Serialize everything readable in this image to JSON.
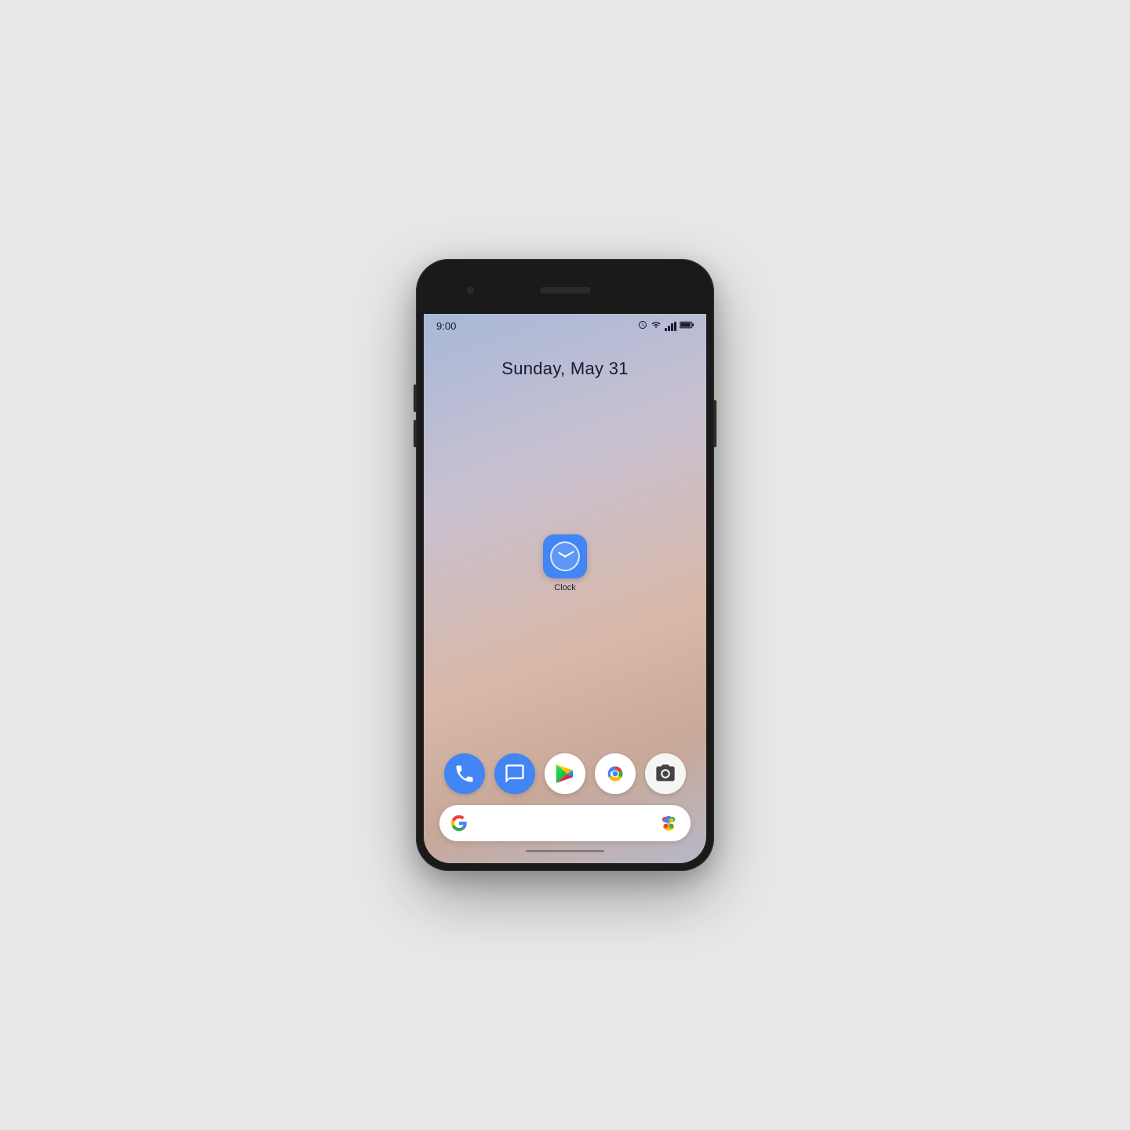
{
  "phone": {
    "status_bar": {
      "time": "9:00",
      "icons": [
        "alarm",
        "wifi",
        "signal",
        "battery"
      ]
    },
    "date": "Sunday, May 31",
    "clock_app": {
      "label": "Clock"
    },
    "dock": {
      "apps": [
        {
          "name": "Phone",
          "icon_type": "phone"
        },
        {
          "name": "Messages",
          "icon_type": "messages"
        },
        {
          "name": "Play Store",
          "icon_type": "playstore"
        },
        {
          "name": "Chrome",
          "icon_type": "chrome"
        },
        {
          "name": "Camera",
          "icon_type": "camera"
        }
      ]
    },
    "search_bar": {
      "placeholder": "",
      "google_label": "G"
    }
  }
}
